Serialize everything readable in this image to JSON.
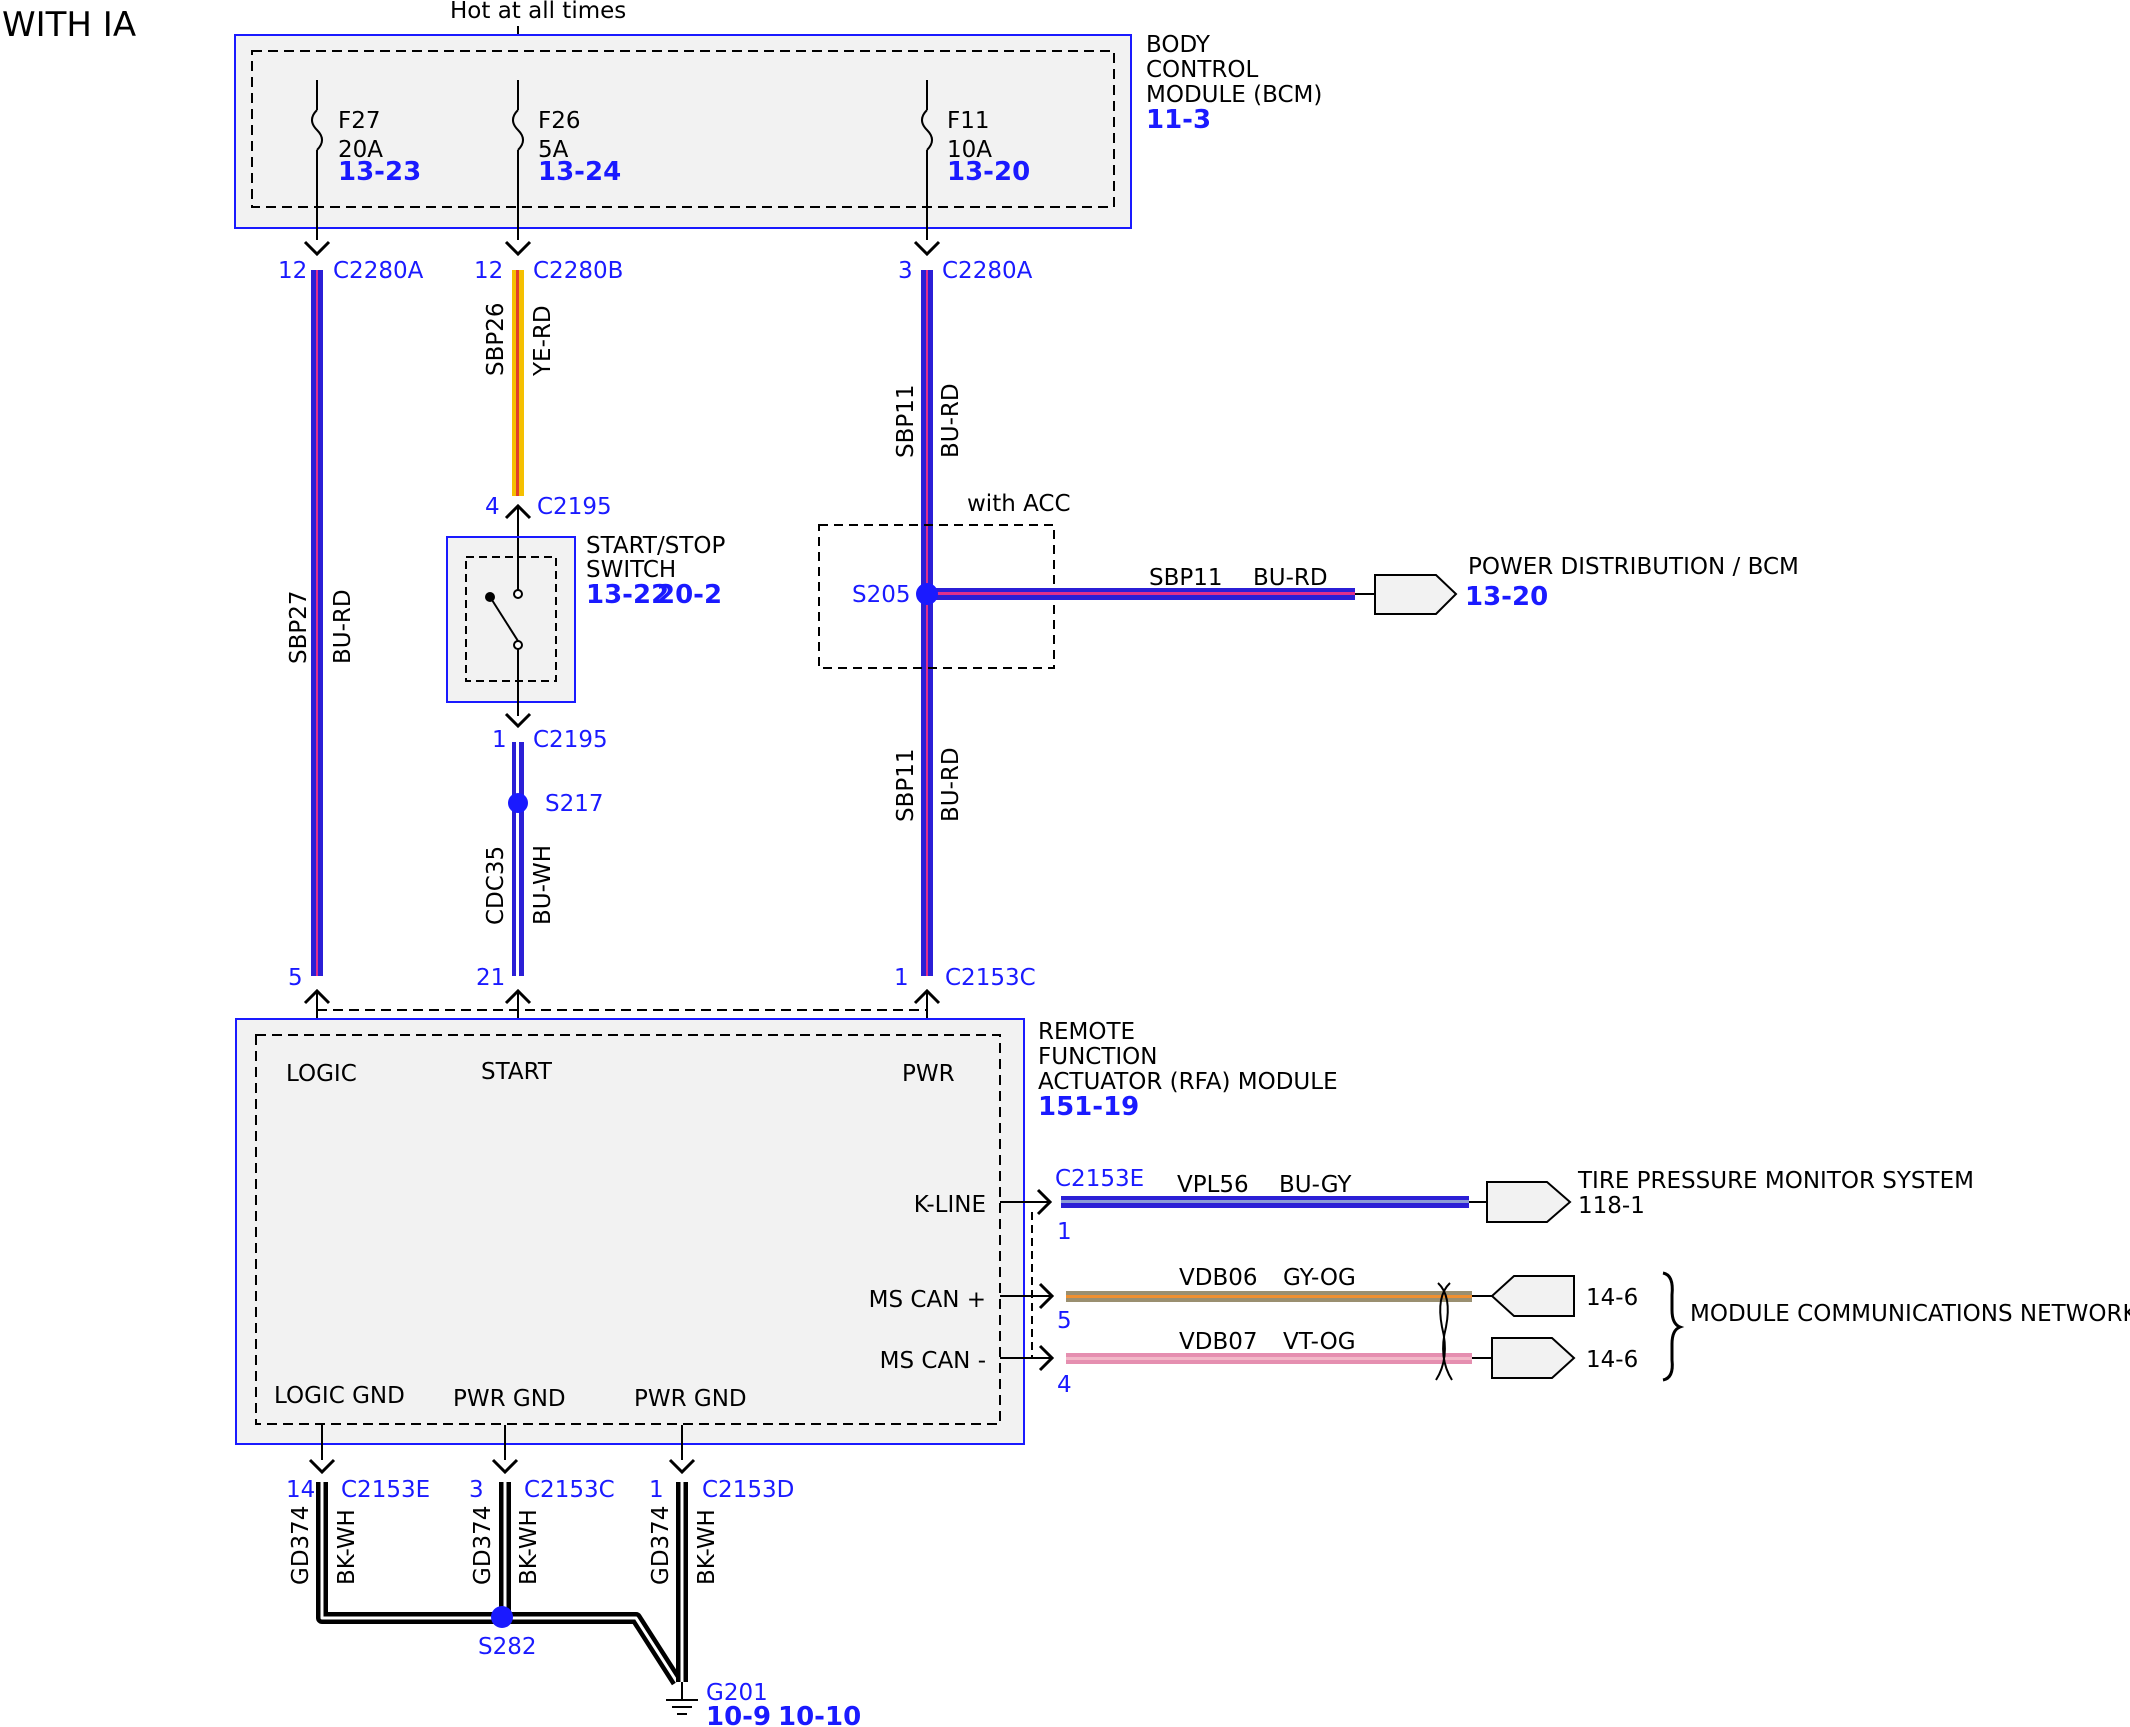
{
  "header": {
    "title": "WITH IA",
    "supply": "Hot at all times"
  },
  "colors": {
    "blue": "#1a1aff",
    "box_fill": "#f2f2f2",
    "wire_bu_rd": "#2b1fd6",
    "wire_bu_rd_stripe": "#e0308c",
    "wire_ye_rd_1": "#f5c000",
    "wire_ye_rd_2": "#e0402a",
    "wire_bu_wh": "#2b1fd6",
    "wire_bk_wh": "#000000",
    "wire_gy_og": "#9a8f70",
    "wire_vt_og": "#e58fb0"
  },
  "bcm": {
    "label1": "BODY",
    "label2": "CONTROL",
    "label3": "MODULE (BCM)",
    "ref": "11-3",
    "fuses": [
      {
        "name": "F27",
        "rating": "20A",
        "ref": "13-23"
      },
      {
        "name": "F26",
        "rating": "5A",
        "ref": "13-24"
      },
      {
        "name": "F11",
        "rating": "10A",
        "ref": "13-20"
      }
    ]
  },
  "bcm_connectors": [
    {
      "pin": "12",
      "conn": "C2280A"
    },
    {
      "pin": "12",
      "conn": "C2280B"
    },
    {
      "pin": "3",
      "conn": "C2280A"
    }
  ],
  "wires": {
    "sbp27": {
      "circuit": "SBP27",
      "color": "BU-RD"
    },
    "sbp26": {
      "circuit": "SBP26",
      "color": "YE-RD"
    },
    "sbp11_upper": {
      "circuit": "SBP11",
      "color": "BU-RD"
    },
    "sbp11_lower": {
      "circuit": "SBP11",
      "color": "BU-RD"
    },
    "sbp11_branch": {
      "circuit": "SBP11",
      "color": "BU-RD"
    },
    "cdc35": {
      "circuit": "CDC35",
      "color": "BU-WH"
    },
    "vpl56": {
      "circuit": "VPL56",
      "color": "BU-GY"
    },
    "vdb06": {
      "circuit": "VDB06",
      "color": "GY-OG"
    },
    "vdb07": {
      "circuit": "VDB07",
      "color": "VT-OG"
    },
    "gd374": [
      {
        "circuit": "GD374",
        "color": "BK-WH"
      },
      {
        "circuit": "GD374",
        "color": "BK-WH"
      },
      {
        "circuit": "GD374",
        "color": "BK-WH"
      }
    ]
  },
  "switch": {
    "label1": "START/STOP",
    "label2": "SWITCH",
    "ref1": "13-22",
    "ref2": "20-2",
    "top_pin": "4",
    "top_conn": "C2195",
    "bottom_pin": "1",
    "bottom_conn": "C2195"
  },
  "splices": {
    "s217": "S217",
    "s205": "S205",
    "s282": "S282"
  },
  "acc": {
    "label": "with ACC"
  },
  "power_dist": {
    "label": "POWER DISTRIBUTION / BCM",
    "ref": "13-20"
  },
  "rfa_connectors": [
    {
      "pin": "5",
      "conn": ""
    },
    {
      "pin": "21",
      "conn": ""
    },
    {
      "pin": "1",
      "conn": "C2153C"
    }
  ],
  "rfa": {
    "label1": "REMOTE",
    "label2": "FUNCTION",
    "label3": "ACTUATOR (RFA) MODULE",
    "ref": "151-19",
    "pins_top": [
      "LOGIC",
      "START",
      "PWR"
    ],
    "pins_right": [
      "K-LINE",
      "MS CAN +",
      "MS CAN -"
    ],
    "pins_bottom": [
      "LOGIC GND",
      "PWR GND",
      "PWR GND"
    ]
  },
  "kline": {
    "conn": "C2153E",
    "pin": "1"
  },
  "mscan": {
    "plus_pin": "5",
    "minus_pin": "4"
  },
  "tpms": {
    "label": "TIRE PRESSURE MONITOR SYSTEM",
    "ref": "118-1"
  },
  "mcn": {
    "label": "MODULE COMMUNICATIONS NETWORK",
    "ref_plus": "14-6",
    "ref_minus": "14-6"
  },
  "ground_connectors": [
    {
      "pin": "14",
      "conn": "C2153E"
    },
    {
      "pin": "3",
      "conn": "C2153C"
    },
    {
      "pin": "1",
      "conn": "C2153D"
    }
  ],
  "ground": {
    "name": "G201",
    "ref1": "10-9",
    "ref2": "10-10"
  }
}
